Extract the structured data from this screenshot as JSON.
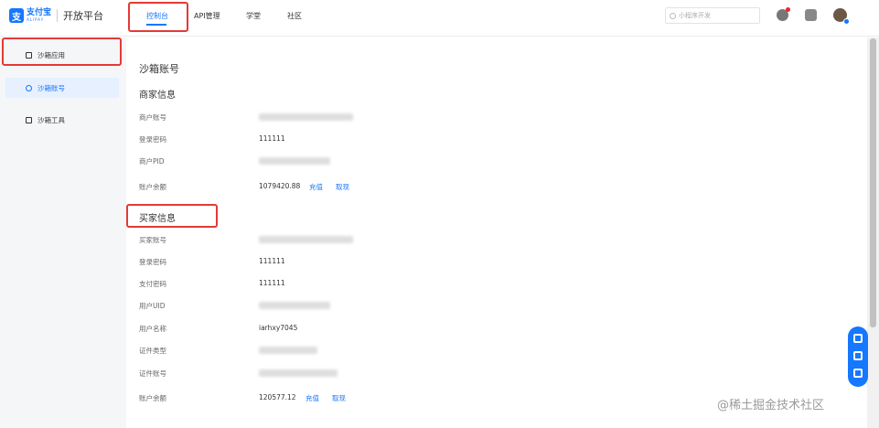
{
  "header": {
    "logo_mark": "支",
    "logo_cn": "支付宝",
    "logo_en": "ALIPAY",
    "platform": "开放平台",
    "nav": [
      {
        "label": "控制台",
        "active": true
      },
      {
        "label": "API管理",
        "active": false
      },
      {
        "label": "学堂",
        "active": false
      },
      {
        "label": "社区",
        "active": false
      }
    ],
    "search_placeholder": "小程序开发"
  },
  "sidebar": {
    "items": [
      {
        "label": "沙箱应用",
        "icon": "cube-icon",
        "active": false
      },
      {
        "label": "沙箱账号",
        "icon": "user-icon",
        "active": true
      },
      {
        "label": "沙箱工具",
        "icon": "tool-icon",
        "active": false
      }
    ]
  },
  "main": {
    "page_title": "沙箱账号",
    "merchant": {
      "title": "商家信息",
      "fields": {
        "account_label": "商户账号",
        "password_label": "登录密码",
        "password_value": "111111",
        "pid_label": "商户PID",
        "balance_label": "账户余额",
        "balance_value": "1079420.88",
        "recharge": "充值",
        "withdraw": "取现"
      }
    },
    "buyer": {
      "title": "买家信息",
      "fields": {
        "account_label": "买家账号",
        "login_password_label": "登录密码",
        "login_password_value": "111111",
        "pay_password_label": "支付密码",
        "pay_password_value": "111111",
        "uid_label": "用户UID",
        "name_label": "用户名称",
        "name_value": "iarhxy7045",
        "id_type_label": "证件类型",
        "id_number_label": "证件账号",
        "balance_label": "账户余额",
        "balance_value": "120577.12",
        "recharge": "充值",
        "withdraw": "取现"
      }
    }
  },
  "watermark": "@稀土掘金技术社区",
  "colors": {
    "accent": "#1677ff",
    "highlight": "#e53935"
  }
}
